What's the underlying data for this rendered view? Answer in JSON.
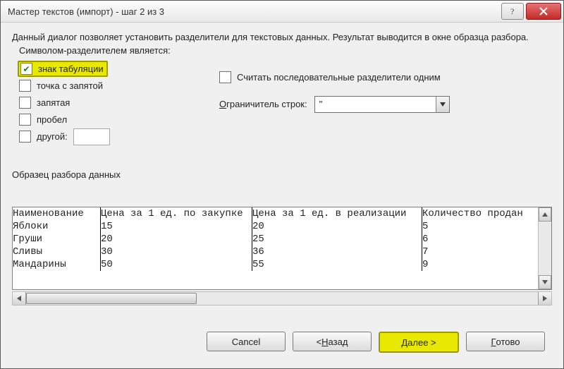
{
  "title": "Мастер текстов (импорт) - шаг 2 из 3",
  "intro": "Данный диалог позволяет установить разделители для текстовых данных. Результат выводится в окне образца разбора.",
  "delimGroup": {
    "legend": "Символом-разделителем является:",
    "tab": "знак табуляции",
    "semicolon": "точка с запятой",
    "comma": "запятая",
    "space": "пробел",
    "other": "другой:",
    "otherValue": ""
  },
  "consecutive": "Считать последовательные разделители одним",
  "qualifier": {
    "label": "Ограничитель строк:",
    "value": "\""
  },
  "previewLegend": "Образец разбора данных",
  "previewHeaders": [
    "Наименование",
    "Цена за 1 ед. по закупке",
    "Цена за 1 ед. в реализации",
    "Количество продан"
  ],
  "previewRows": [
    [
      "Яблоки",
      "15",
      "20",
      "5"
    ],
    [
      "Груши",
      "20",
      "25",
      "6"
    ],
    [
      "Сливы",
      "30",
      "36",
      "7"
    ],
    [
      "Мандарины",
      "50",
      "55",
      "9"
    ]
  ],
  "buttons": {
    "cancel": "Cancel",
    "back_prefix": "< ",
    "back_u": "Н",
    "back_rest": "азад",
    "next_u": "Д",
    "next_rest": "алее >",
    "finish_u": "Г",
    "finish_rest": "отово"
  }
}
